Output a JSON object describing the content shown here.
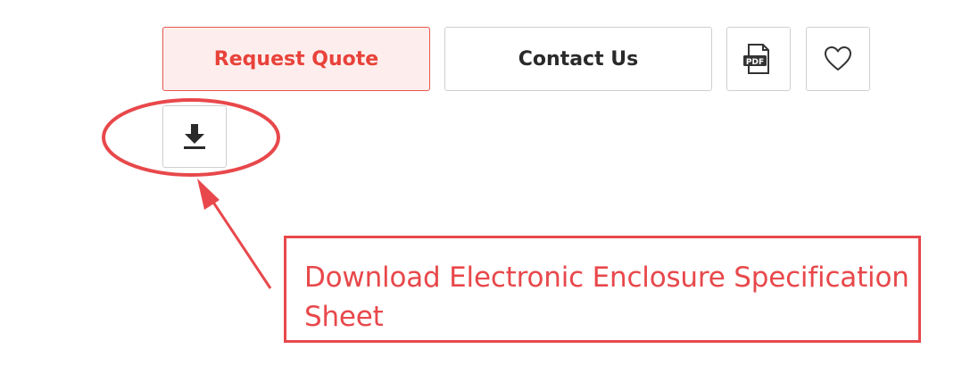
{
  "actions": {
    "request_quote_label": "Request Quote",
    "contact_us_label": "Contact Us"
  },
  "icons": {
    "pdf_text": "PDF",
    "pdf": "pdf-file-icon",
    "wishlist": "heart-icon",
    "download": "download-icon"
  },
  "annotation": {
    "callout_text": "Download Electronic Enclosure Specification Sheet",
    "color": "#e8484b"
  },
  "colors": {
    "accent": "#e8423a",
    "accent_bg": "#fdeeed",
    "border": "#cfcfcf",
    "text_dark": "#2a2a2a"
  }
}
